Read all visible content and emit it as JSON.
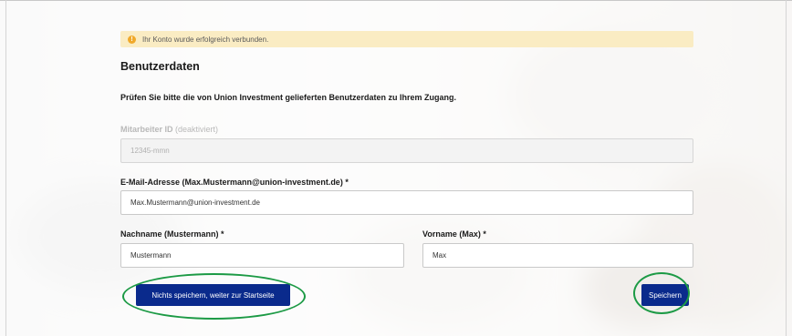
{
  "alert": {
    "text": "Ihr Konto wurde erfolgreich verbunden."
  },
  "page": {
    "heading": "Benutzerdaten",
    "intro": "Prüfen Sie bitte die von Union Investment gelieferten Benutzerdaten zu Ihrem Zugang."
  },
  "fields": {
    "employee_id": {
      "label": "Mitarbeiter ID",
      "hint": "(deaktiviert)",
      "value": "12345-mmn"
    },
    "email": {
      "label": "E-Mail-Adresse (Max.Mustermann@union-investment.de) *",
      "value": "Max.Mustermann@union-investment.de"
    },
    "last_name": {
      "label": "Nachname (Mustermann) *",
      "value": "Mustermann"
    },
    "first_name": {
      "label": "Vorname (Max) *",
      "value": "Max"
    }
  },
  "buttons": {
    "skip": "Nichts speichern, weiter zur Startseite",
    "save": "Speichern"
  },
  "colors": {
    "primary_button": "#0a2a8c",
    "alert_background": "#faecc3",
    "alert_icon": "#f0a92b",
    "highlight_ring": "#1c9a45"
  }
}
